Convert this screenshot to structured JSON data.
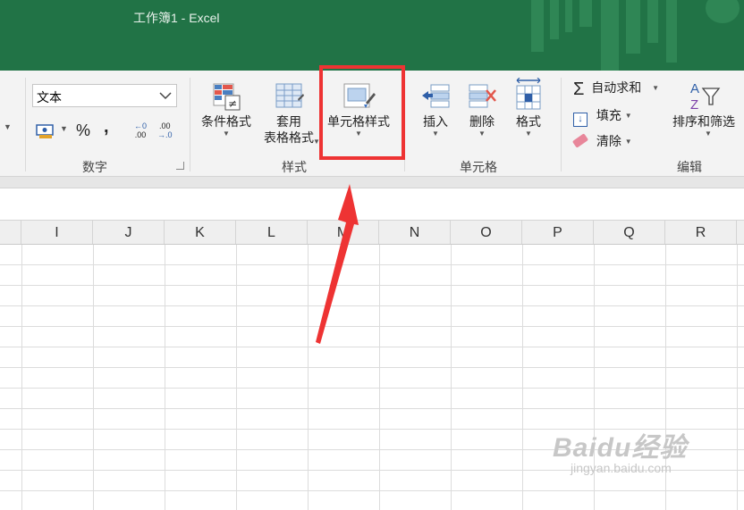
{
  "window": {
    "title": "工作簿1  -  Excel"
  },
  "ribbon": {
    "number_group": {
      "format_value": "文本",
      "percent": "%",
      "comma": ",",
      "increase_decimal_top": "←0",
      "increase_decimal_bottom": ".00",
      "decrease_decimal_top": ".00",
      "decrease_decimal_bottom": "→.0",
      "label": "数字"
    },
    "styles_group": {
      "conditional_format": "条件格式",
      "table_format_line1": "套用",
      "table_format_line2": "表格格式",
      "cell_styles": "单元格样式",
      "label": "样式"
    },
    "cells_group": {
      "insert": "插入",
      "delete": "删除",
      "format": "格式",
      "label": "单元格"
    },
    "editing_group": {
      "autosum": "自动求和",
      "fill": "填充",
      "clear": "清除",
      "sort_filter": "排序和筛选",
      "label": "编辑"
    }
  },
  "grid": {
    "columns": [
      "I",
      "J",
      "K",
      "L",
      "M",
      "N",
      "O",
      "P",
      "Q",
      "R"
    ]
  },
  "watermark": {
    "main": "Baidu经验",
    "sub": "jingyan.baidu.com"
  },
  "colors": {
    "excel_green": "#217346",
    "annotation_red": "#ee3333"
  }
}
